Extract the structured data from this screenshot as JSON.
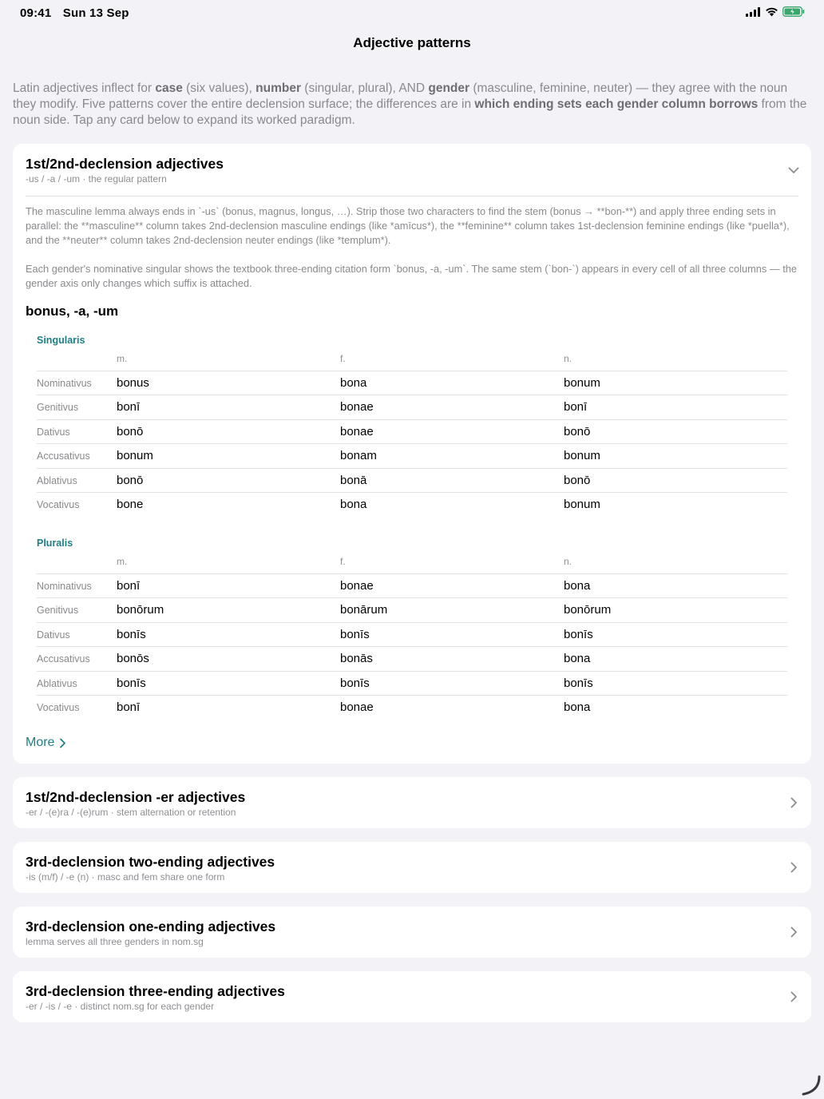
{
  "status": {
    "time": "09:41",
    "date": "Sun 13 Sep"
  },
  "nav": {
    "title": "Adjective patterns"
  },
  "intro": {
    "p1": "Latin adjectives inflect for ",
    "b1": "case",
    "p2": " (six values), ",
    "b2": "number",
    "p3": " (singular, plural), AND ",
    "b3": "gender",
    "p4": " (masculine, feminine, neuter) — they agree with the noun they modify. Five patterns cover the entire declension surface; the differences are in ",
    "b4": "which ending sets each gender column borrows",
    "p5": " from the noun side. Tap any card below to expand its worked paradigm."
  },
  "expanded": {
    "title": "1st/2nd-declension adjectives",
    "subtitle": "-us / -a / -um · the regular pattern",
    "desc1": "The masculine lemma always ends in `-us` (bonus, magnus, longus, …). Strip those two characters to find the stem (bonus → **bon-**) and apply three ending sets in parallel: the **masculine** column takes 2nd-declension masculine endings (like *amīcus*), the **feminine** column takes 1st-declension feminine endings (like *puella*), and the **neuter** column takes 2nd-declension neuter endings (like *templum*).",
    "desc2": "Each gender's nominative singular shows the textbook three-ending citation form `bonus, -a, -um`. The same stem (`bon-`) appears in every cell of all three columns — the gender axis only changes which suffix is attached.",
    "lemma": "bonus, -a, -um",
    "headers": {
      "m": "m.",
      "f": "f.",
      "n": "n."
    },
    "singular": {
      "label": "Singularis",
      "rows": [
        {
          "case": "Nominativus",
          "m": "bonus",
          "f": "bona",
          "n": "bonum"
        },
        {
          "case": "Genitivus",
          "m": "bonī",
          "f": "bonae",
          "n": "bonī"
        },
        {
          "case": "Dativus",
          "m": "bonō",
          "f": "bonae",
          "n": "bonō"
        },
        {
          "case": "Accusativus",
          "m": "bonum",
          "f": "bonam",
          "n": "bonum"
        },
        {
          "case": "Ablativus",
          "m": "bonō",
          "f": "bonā",
          "n": "bonō"
        },
        {
          "case": "Vocativus",
          "m": "bone",
          "f": "bona",
          "n": "bonum"
        }
      ]
    },
    "plural": {
      "label": "Pluralis",
      "rows": [
        {
          "case": "Nominativus",
          "m": "bonī",
          "f": "bonae",
          "n": "bona"
        },
        {
          "case": "Genitivus",
          "m": "bonōrum",
          "f": "bonārum",
          "n": "bonōrum"
        },
        {
          "case": "Dativus",
          "m": "bonīs",
          "f": "bonīs",
          "n": "bonīs"
        },
        {
          "case": "Accusativus",
          "m": "bonōs",
          "f": "bonās",
          "n": "bona"
        },
        {
          "case": "Ablativus",
          "m": "bonīs",
          "f": "bonīs",
          "n": "bonīs"
        },
        {
          "case": "Vocativus",
          "m": "bonī",
          "f": "bonae",
          "n": "bona"
        }
      ]
    },
    "more_label": "More"
  },
  "cards": [
    {
      "title": "1st/2nd-declension -er adjectives",
      "subtitle": "-er / -(e)ra / -(e)rum · stem alternation or retention"
    },
    {
      "title": "3rd-declension two-ending adjectives",
      "subtitle": "-is (m/f) / -e (n) · masc and fem share one form"
    },
    {
      "title": "3rd-declension one-ending adjectives",
      "subtitle": "lemma serves all three genders in nom.sg"
    },
    {
      "title": "3rd-declension three-ending adjectives",
      "subtitle": "-er / -is / -e · distinct nom.sg for each gender"
    }
  ],
  "colors": {
    "accent": "#1c7f86",
    "background": "#f2f2f7",
    "card": "#ffffff"
  }
}
